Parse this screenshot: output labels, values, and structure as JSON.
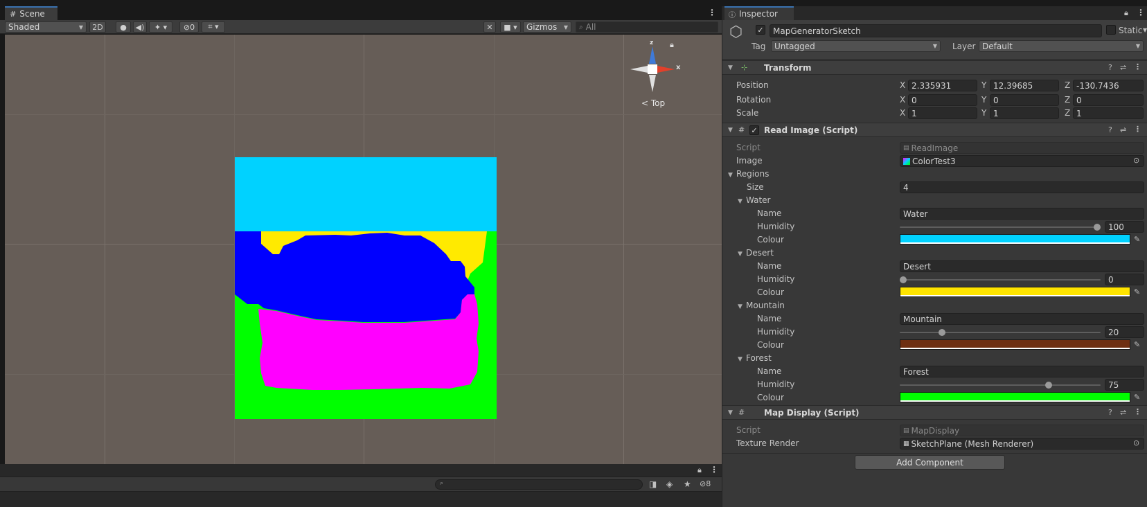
{
  "scene": {
    "tab_label": "Scene",
    "shading_mode": "Shaded",
    "btn_2d": "2D",
    "hidden_count": "0",
    "gizmos_label": "Gizmos",
    "search_placeholder": "All",
    "view_label": "Top",
    "axis_z": "z",
    "axis_x": "x",
    "bottom_hidden_count": "8",
    "map_colors": {
      "water": "#00d2ff",
      "desert": "#ffea00",
      "mountain_region": "#0000ff",
      "magenta": "#ff00ff",
      "forest": "#00ff00"
    }
  },
  "inspector": {
    "tab_label": "Inspector",
    "object_name": "MapGeneratorSketch",
    "static_label": "Static",
    "tag_label": "Tag",
    "tag_value": "Untagged",
    "layer_label": "Layer",
    "layer_value": "Default",
    "transform": {
      "title": "Transform",
      "position_label": "Position",
      "rotation_label": "Rotation",
      "scale_label": "Scale",
      "position": {
        "x": "2.335931",
        "y": "12.39685",
        "z": "-130.7436"
      },
      "rotation": {
        "x": "0",
        "y": "0",
        "z": "0"
      },
      "scale": {
        "x": "1",
        "y": "1",
        "z": "1"
      },
      "axis_x": "X",
      "axis_y": "Y",
      "axis_z": "Z"
    },
    "read_image": {
      "title": "Read Image (Script)",
      "script_label": "Script",
      "script_value": "ReadImage",
      "image_label": "Image",
      "image_value": "ColorTest3",
      "regions_label": "Regions",
      "size_label": "Size",
      "size_value": "4",
      "name_label": "Name",
      "humidity_label": "Humidity",
      "colour_label": "Colour",
      "regions": [
        {
          "header": "Water",
          "name": "Water",
          "humidity": "100",
          "humidity_fraction": 1.0,
          "colour": "#00d2ff"
        },
        {
          "header": "Desert",
          "name": "Desert",
          "humidity": "0",
          "humidity_fraction": 0.0,
          "colour": "#ffe400"
        },
        {
          "header": "Mountain",
          "name": "Mountain",
          "humidity": "20",
          "humidity_fraction": 0.2,
          "colour": "#6e2f12"
        },
        {
          "header": "Forest",
          "name": "Forest",
          "humidity": "75",
          "humidity_fraction": 0.75,
          "colour": "#00ff00"
        }
      ]
    },
    "map_display": {
      "title": "Map Display (Script)",
      "script_label": "Script",
      "script_value": "MapDisplay",
      "texture_label": "Texture Render",
      "texture_value": "SketchPlane (Mesh Renderer)"
    },
    "add_component": "Add Component"
  }
}
